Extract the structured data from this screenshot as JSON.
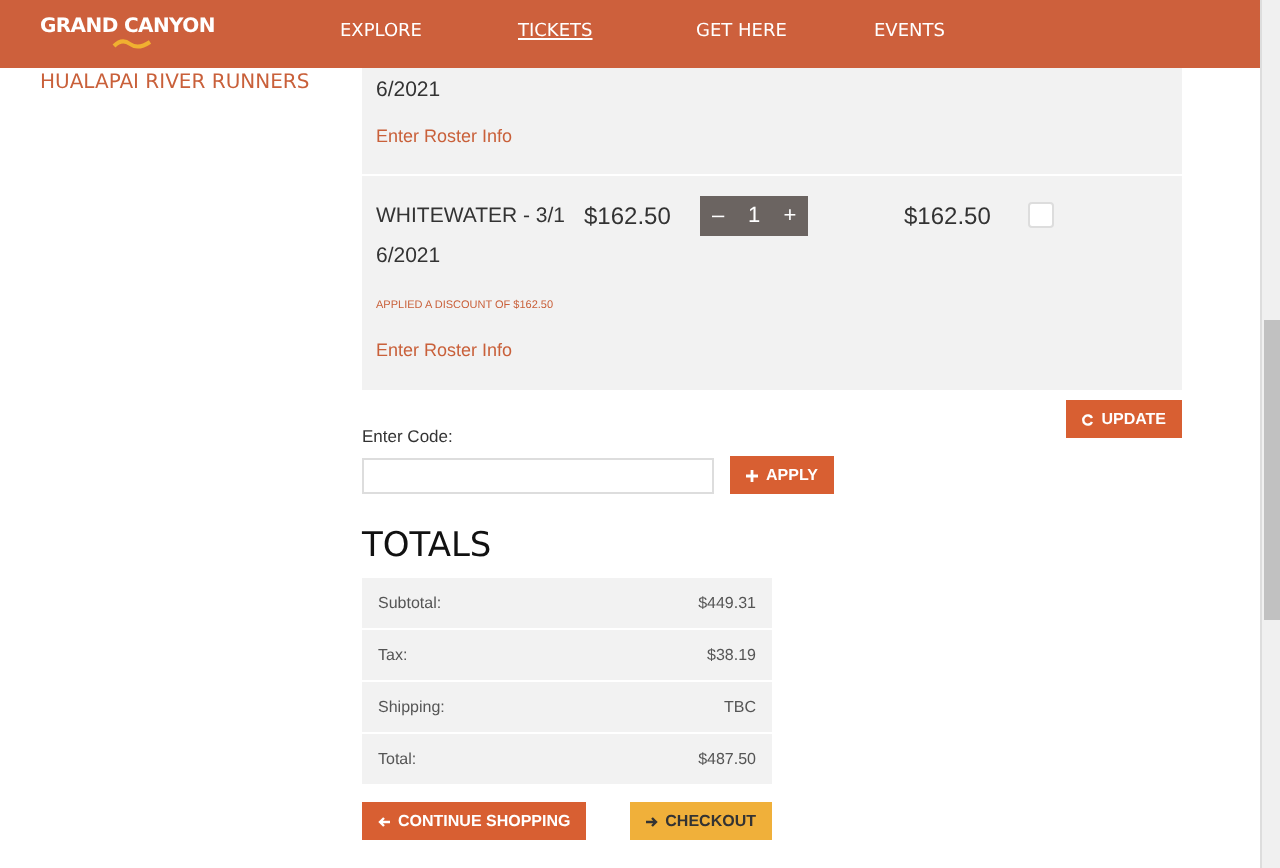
{
  "navbar": {
    "logo_text": "GRAND CANYON",
    "links": [
      {
        "label": "EXPLORE",
        "selected": false
      },
      {
        "label": "TICKETS",
        "selected": true
      },
      {
        "label": "GET HERE",
        "selected": false
      },
      {
        "label": "EVENTS",
        "selected": false
      }
    ]
  },
  "sidebar": {
    "links": [
      "HUALAPAI RIVER RUNNERS"
    ]
  },
  "cart": {
    "items": [
      {
        "name_lines": [
          "6/2021"
        ],
        "roster_link": "Enter Roster Info"
      },
      {
        "name_lines": [
          "WHITEWATER - 3/1",
          "6/2021"
        ],
        "price": "$162.50",
        "quantity": "1",
        "total": "$162.50",
        "checked": false,
        "discount": "APPLIED A DISCOUNT OF $162.50",
        "roster_link": "Enter Roster Info"
      }
    ],
    "minus": "–",
    "plus": "+",
    "update_button": "UPDATE"
  },
  "coupon": {
    "label": "Enter Code:",
    "apply_button": "APPLY"
  },
  "totals": {
    "title": "TOTALS",
    "rows": [
      {
        "label": "Subtotal:",
        "value": "$449.31"
      },
      {
        "label": "Tax:",
        "value": "$38.19"
      },
      {
        "label": "Shipping:",
        "value": "TBC"
      },
      {
        "label": "Total:",
        "value": "$487.50"
      }
    ]
  },
  "buttons": {
    "continue": "CONTINUE SHOPPING",
    "checkout": "CHECKOUT"
  }
}
